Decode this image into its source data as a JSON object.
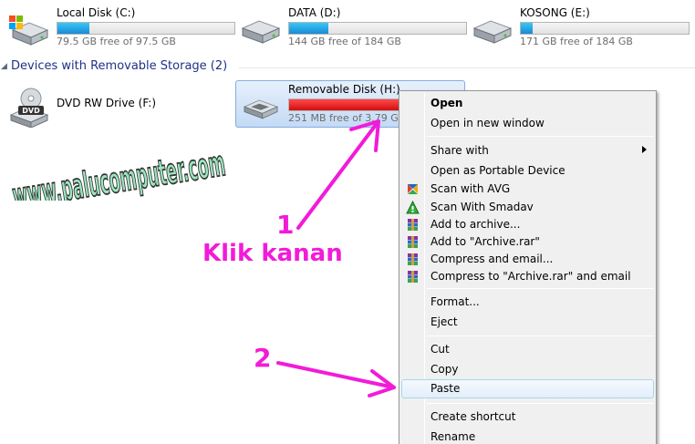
{
  "drives": [
    {
      "name": "Local Disk (C:)",
      "free": "79.5 GB free of 97.5 GB",
      "used_fraction": 0.18,
      "icon": "windows-disk-icon"
    },
    {
      "name": "DATA (D:)",
      "free": "144 GB free of 184 GB",
      "used_fraction": 0.22,
      "icon": "hard-disk-icon"
    },
    {
      "name": "KOSONG (E:)",
      "free": "171 GB free of 184 GB",
      "used_fraction": 0.07,
      "icon": "hard-disk-icon"
    }
  ],
  "removable_section": {
    "title": "Devices with Removable Storage (2)"
  },
  "dvd_drive": {
    "name": "DVD RW Drive (F:)",
    "icon": "dvd-drive-icon",
    "badge": "DVD"
  },
  "removable_disk": {
    "name": "Removable Disk (H:)",
    "free": "251 MB free of 3.79 GB",
    "used_fraction": 0.93,
    "icon": "removable-disk-icon"
  },
  "watermark": {
    "text": "www.palucomputer.com"
  },
  "context_menu": {
    "open": "Open",
    "open_new_window": "Open in new window",
    "share_with": "Share with",
    "open_portable": "Open as Portable Device",
    "scan_avg": "Scan with AVG",
    "scan_smadav": "Scan With Smadav",
    "add_archive": "Add to archive...",
    "add_archive_rar": "Add to \"Archive.rar\"",
    "compress_email": "Compress and email...",
    "compress_rar_email": "Compress to \"Archive.rar\" and email",
    "format": "Format...",
    "eject": "Eject",
    "cut": "Cut",
    "copy": "Copy",
    "paste": "Paste",
    "create_shortcut": "Create shortcut",
    "rename": "Rename"
  },
  "annotations": {
    "step1_number": "1",
    "step1_text": "Klik kanan",
    "step2_number": "2",
    "color": "#f21bd8"
  }
}
